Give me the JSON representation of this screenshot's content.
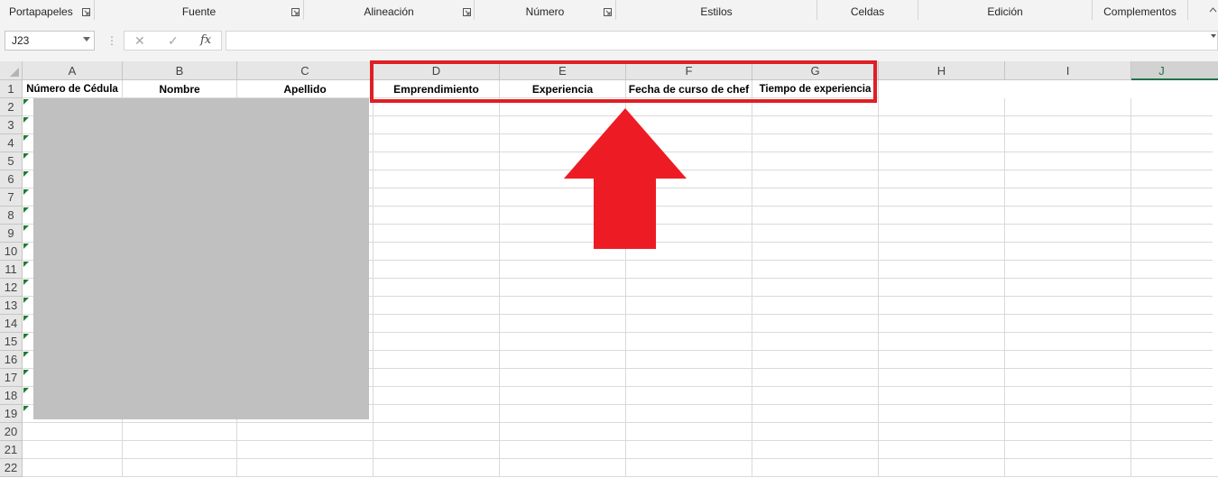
{
  "ribbon": {
    "groups": [
      {
        "label": "Portapapeles",
        "launcher": true
      },
      {
        "label": "Fuente",
        "launcher": true
      },
      {
        "label": "Alineación",
        "launcher": true
      },
      {
        "label": "Número",
        "launcher": true
      },
      {
        "label": "Estilos",
        "launcher": false
      },
      {
        "label": "Celdas",
        "launcher": false
      },
      {
        "label": "Edición",
        "launcher": false
      },
      {
        "label": "Complementos",
        "launcher": false
      }
    ]
  },
  "formula_bar": {
    "name_box": "J23",
    "cancel_icon": "✕",
    "enter_icon": "✓",
    "function_icon": "fx",
    "value": ""
  },
  "columns": [
    "A",
    "B",
    "C",
    "D",
    "E",
    "F",
    "G",
    "H",
    "I",
    "J"
  ],
  "selected_column": "J",
  "rows": [
    "1",
    "2",
    "3",
    "4",
    "5",
    "6",
    "7",
    "8",
    "9",
    "10",
    "11",
    "12",
    "13",
    "14",
    "15",
    "16",
    "17",
    "18",
    "19",
    "20",
    "21",
    "22"
  ],
  "header_row": {
    "A": "Número de Cédula",
    "B": "Nombre",
    "C": "Apellido",
    "D": "Emprendimiento",
    "E": "Experiencia",
    "F": "Fecha de curso de chef",
    "G": "Tiempo de experiencia"
  },
  "colors": {
    "highlight": "#e01e25",
    "arrow": "#ed1c24",
    "redacted": "#c0c0c0",
    "selection": "#217346",
    "error_indicator": "#1e7d32"
  }
}
